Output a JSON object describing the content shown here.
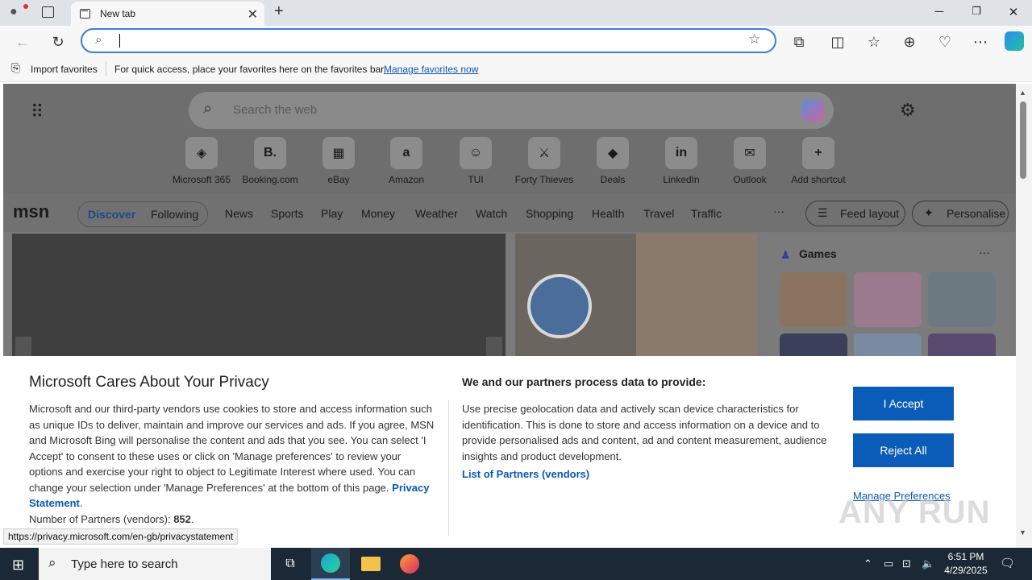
{
  "browser": {
    "tab_title": "New tab",
    "address_value": "",
    "favbar": {
      "import_label": "Import favorites",
      "hint": "For quick access, place your favorites here on the favorites bar.",
      "manage_link": "Manage favorites now"
    }
  },
  "newtab": {
    "search_placeholder": "Search the web",
    "shortcuts": [
      {
        "label": "Microsoft 365",
        "glyph": "◈"
      },
      {
        "label": "Booking.com",
        "glyph": "B."
      },
      {
        "label": "eBay",
        "glyph": "▦"
      },
      {
        "label": "Amazon",
        "glyph": "a"
      },
      {
        "label": "TUI",
        "glyph": "☺"
      },
      {
        "label": "Forty Thieves",
        "glyph": "⚔"
      },
      {
        "label": "Deals",
        "glyph": "◆"
      },
      {
        "label": "LinkedIn",
        "glyph": "in"
      },
      {
        "label": "Outlook",
        "glyph": "✉"
      },
      {
        "label": "Add shortcut",
        "glyph": "+"
      }
    ],
    "msn": {
      "logo": "msn",
      "tabs": [
        "Discover",
        "Following"
      ],
      "categories": [
        "News",
        "Sports",
        "Play",
        "Money",
        "Weather",
        "Watch",
        "Shopping",
        "Health",
        "Travel",
        "Traffic"
      ],
      "more": "···",
      "feed_layout": "Feed layout",
      "personalise": "Personalise",
      "games_title": "Games",
      "games_more": "···"
    }
  },
  "privacy": {
    "title": "Microsoft Cares About Your Privacy",
    "body": "Microsoft and our third-party vendors use cookies to store and access information such as unique IDs to deliver, maintain and improve our services and ads. If you agree, MSN and Microsoft Bing will personalise the content and ads that you see. You can select 'I Accept' to consent to these uses or click on 'Manage preferences' to review your options and exercise your right to object to Legitimate Interest where used.  You can change your selection under 'Manage Preferences' at the bottom of this page.",
    "privacy_link": "Privacy Statement",
    "partners_count_label": "Number of Partners (vendors):",
    "partners_count": "852",
    "data_heading": "We and our partners process data to provide:",
    "data_body": "Use precise geolocation data and actively scan device characteristics for identification. This is done to store and access information on a device and to provide personalised ads and content, ad and content measurement, audience insights and product development.",
    "partners_link": "List of Partners (vendors)",
    "accept": "I Accept",
    "reject": "Reject All",
    "manage": "Manage Preferences"
  },
  "status_url": "https://privacy.microsoft.com/en-gb/privacystatement",
  "watermark": "ANY RUN",
  "taskbar": {
    "search_placeholder": "Type here to search",
    "time": "6:51 PM",
    "date": "4/29/2025"
  }
}
